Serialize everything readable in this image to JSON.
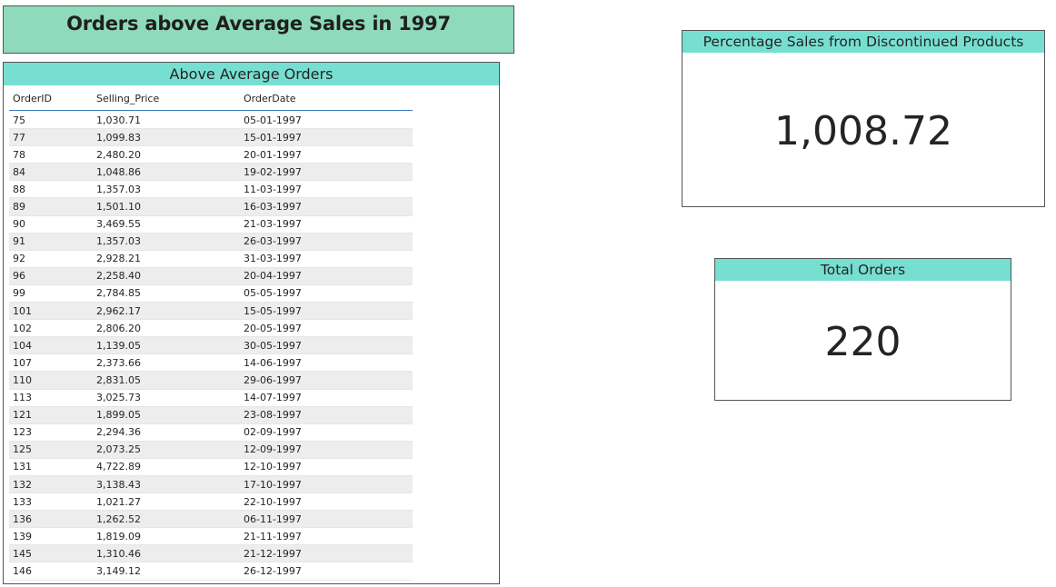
{
  "page_title": "Orders above Average Sales in 1997",
  "colors": {
    "title_bg": "#8fd9bd",
    "header_bg": "#76dfd1",
    "row_alt_bg": "#ededed",
    "header_underline": "#3a7fc1"
  },
  "orders_table": {
    "title": "Above Average Orders",
    "columns": [
      "OrderID",
      "Selling_Price",
      "OrderDate"
    ],
    "rows": [
      [
        "75",
        "1,030.71",
        "05-01-1997"
      ],
      [
        "77",
        "1,099.83",
        "15-01-1997"
      ],
      [
        "78",
        "2,480.20",
        "20-01-1997"
      ],
      [
        "84",
        "1,048.86",
        "19-02-1997"
      ],
      [
        "88",
        "1,357.03",
        "11-03-1997"
      ],
      [
        "89",
        "1,501.10",
        "16-03-1997"
      ],
      [
        "90",
        "3,469.55",
        "21-03-1997"
      ],
      [
        "91",
        "1,357.03",
        "26-03-1997"
      ],
      [
        "92",
        "2,928.21",
        "31-03-1997"
      ],
      [
        "96",
        "2,258.40",
        "20-04-1997"
      ],
      [
        "99",
        "2,784.85",
        "05-05-1997"
      ],
      [
        "101",
        "2,962.17",
        "15-05-1997"
      ],
      [
        "102",
        "2,806.20",
        "20-05-1997"
      ],
      [
        "104",
        "1,139.05",
        "30-05-1997"
      ],
      [
        "107",
        "2,373.66",
        "14-06-1997"
      ],
      [
        "110",
        "2,831.05",
        "29-06-1997"
      ],
      [
        "113",
        "3,025.73",
        "14-07-1997"
      ],
      [
        "121",
        "1,899.05",
        "23-08-1997"
      ],
      [
        "123",
        "2,294.36",
        "02-09-1997"
      ],
      [
        "125",
        "2,073.25",
        "12-09-1997"
      ],
      [
        "131",
        "4,722.89",
        "12-10-1997"
      ],
      [
        "132",
        "3,138.43",
        "17-10-1997"
      ],
      [
        "133",
        "1,021.27",
        "22-10-1997"
      ],
      [
        "136",
        "1,262.52",
        "06-11-1997"
      ],
      [
        "139",
        "1,819.09",
        "21-11-1997"
      ],
      [
        "145",
        "1,310.46",
        "21-12-1997"
      ],
      [
        "146",
        "3,149.12",
        "26-12-1997"
      ]
    ]
  },
  "discontinued_card": {
    "title": "Percentage Sales from Discontinued Products",
    "value": "1,008.72"
  },
  "total_orders_card": {
    "title": "Total Orders",
    "value": "220"
  }
}
